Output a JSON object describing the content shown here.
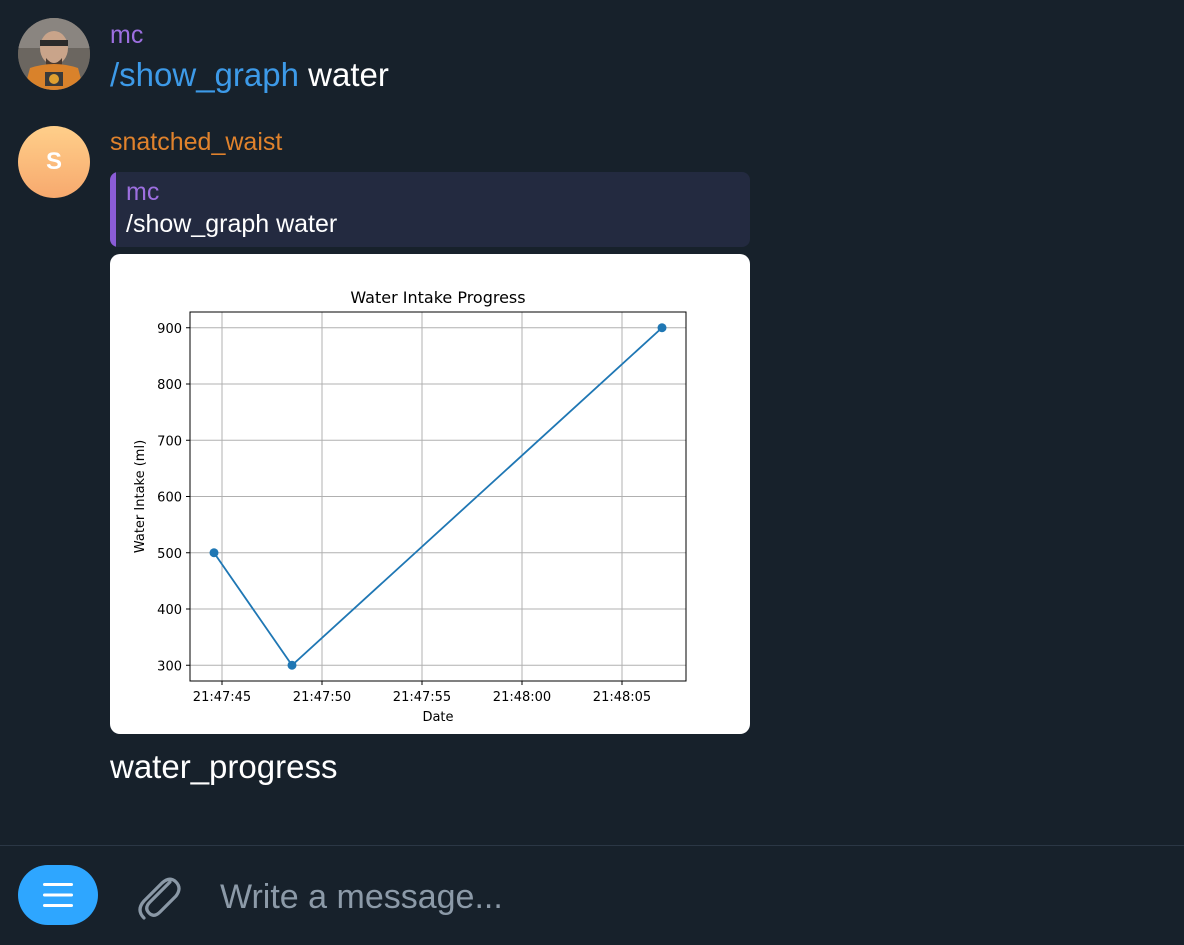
{
  "messages": [
    {
      "sender": "mc",
      "command": "/show_graph",
      "argument": "water"
    },
    {
      "sender": "snatched_waist",
      "avatar_letter": "S",
      "reply": {
        "sender": "mc",
        "text": "/show_graph water"
      },
      "caption": "water_progress"
    }
  ],
  "composer": {
    "placeholder": "Write a message...",
    "menu_icon": "menu-icon",
    "attach_icon": "paperclip-icon"
  },
  "colors": {
    "background": "#17212b",
    "accent": "#2ea6ff",
    "link": "#3d9ae8",
    "mc_name": "#9d6fe0",
    "snatched_name": "#e0822c",
    "series": "#1f77b4"
  },
  "chart_data": {
    "type": "line",
    "title": "Water Intake Progress",
    "xlabel": "Date",
    "ylabel": "Water Intake (ml)",
    "x": [
      "21:47:44.6",
      "21:47:48.5",
      "21:48:07.0"
    ],
    "values": [
      500,
      300,
      900
    ],
    "markers": true,
    "xticks": [
      "21:47:45",
      "21:47:50",
      "21:47:55",
      "21:48:00",
      "21:48:05"
    ],
    "yticks": [
      300,
      400,
      500,
      600,
      700,
      800,
      900
    ],
    "xlim": [
      "21:47:43.4",
      "21:48:08.2"
    ],
    "ylim": [
      272,
      928
    ],
    "grid": true
  }
}
